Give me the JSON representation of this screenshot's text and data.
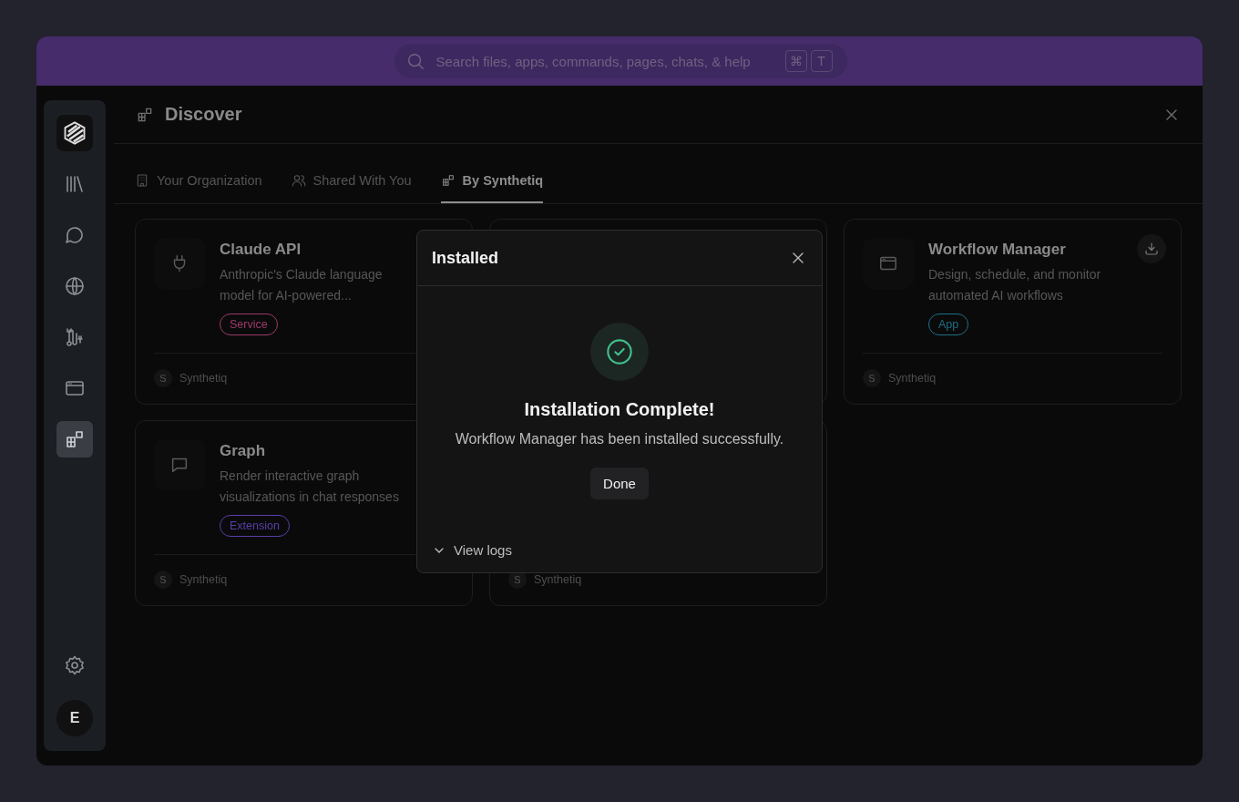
{
  "search": {
    "placeholder": "Search files, apps, commands, pages, chats, & help",
    "keys": [
      "⌘",
      "T"
    ]
  },
  "sidebar": {
    "items": [
      {
        "selected": false
      },
      {
        "selected": false
      },
      {
        "selected": false
      },
      {
        "selected": false
      },
      {
        "selected": false
      },
      {
        "selected": true
      }
    ],
    "avatar": "E"
  },
  "page": {
    "title": "Discover"
  },
  "tabs": [
    {
      "label": "Your Organization",
      "selected": false
    },
    {
      "label": "Shared With You",
      "selected": false
    },
    {
      "label": "By Synthetiq",
      "selected": true
    }
  ],
  "cards": [
    {
      "kind": "full",
      "title": "Claude API",
      "description": "Anthropic's Claude language model for AI-powered...",
      "tag": {
        "label": "Service",
        "color": "#9c3a6a"
      },
      "publisher_initial": "S",
      "publisher": "Synthetiq"
    },
    {
      "kind": "covered"
    },
    {
      "kind": "full",
      "title": "Workflow Manager",
      "description": "Design, schedule, and monitor automated AI workflows",
      "tag": {
        "label": "App",
        "color": "#1f6f86"
      },
      "download": true,
      "publisher_initial": "S",
      "publisher": "Synthetiq"
    },
    {
      "kind": "full",
      "title": "Graph",
      "description": "Render interactive graph visualizations in chat responses",
      "tag": {
        "label": "Extension",
        "color": "#5b3ea8"
      },
      "publisher_initial": "S",
      "publisher": "Synthetiq"
    },
    {
      "kind": "covered",
      "publisher_initial": "S",
      "publisher": "Synthetiq"
    }
  ],
  "dialog": {
    "title": "Installed",
    "heading": "Installation Complete!",
    "message": "Workflow Manager has been installed successfully.",
    "button": "Done",
    "logs_toggle": "View logs",
    "logs_expanded": false
  }
}
